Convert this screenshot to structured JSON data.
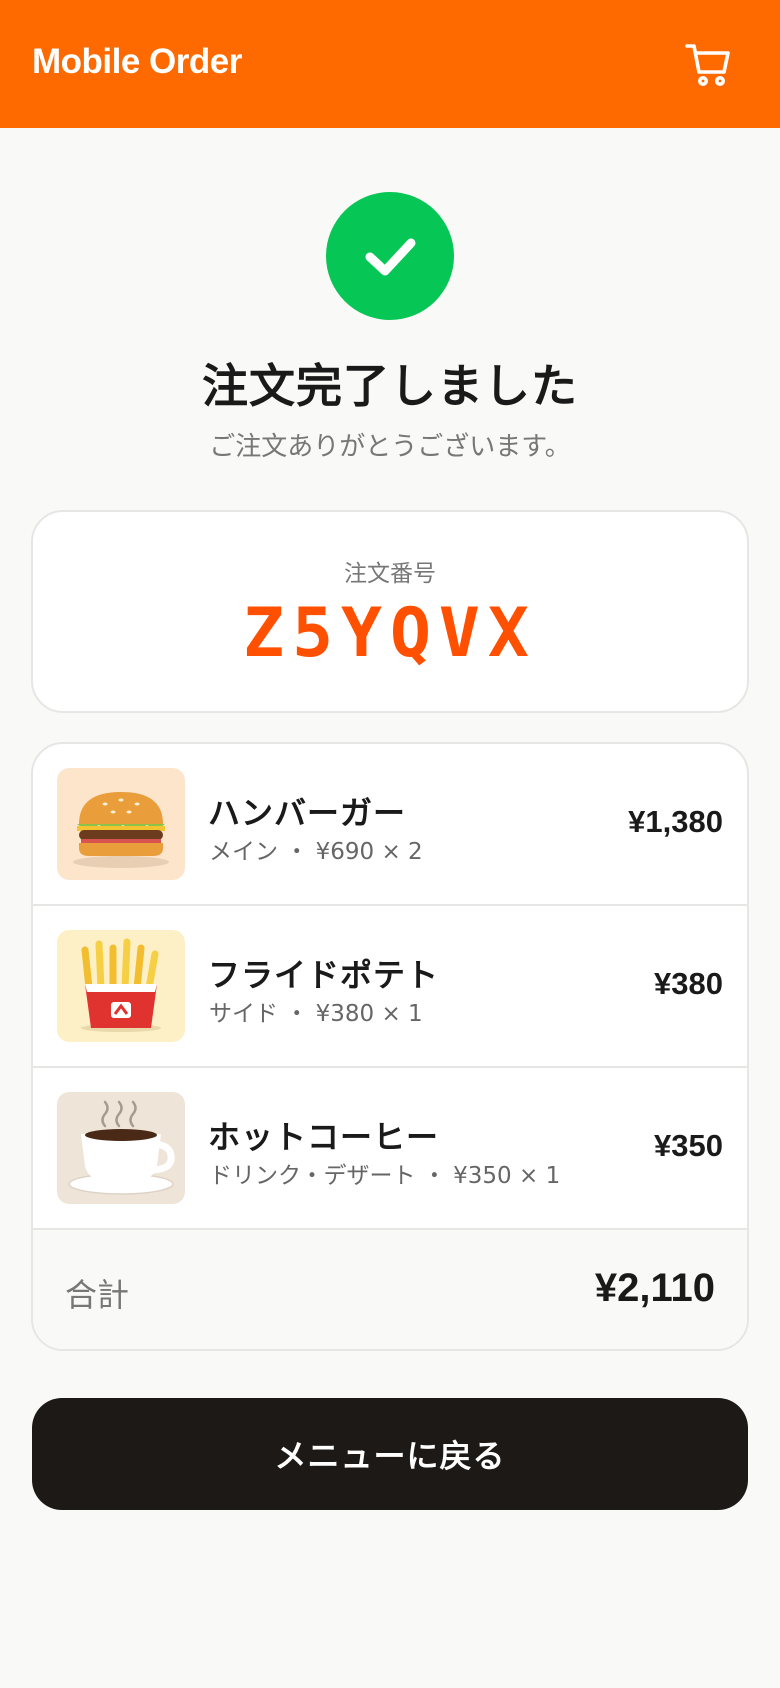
{
  "header": {
    "title": "Mobile Order",
    "cart_icon": "cart-icon",
    "bg_color": "#ff6a00"
  },
  "confirmation": {
    "icon": "check-icon",
    "icon_color": "#06c755",
    "title": "注文完了しました",
    "subtitle": "ご注文ありがとうございます。"
  },
  "order": {
    "label": "注文番号",
    "number": "Z5YQVX",
    "number_color": "#ff4f00"
  },
  "items": [
    {
      "icon": "hamburger-icon",
      "name": "ハンバーガー",
      "meta": "メイン ・ ¥690 × 2",
      "price": "¥1,380"
    },
    {
      "icon": "french-fries-icon",
      "name": "フライドポテト",
      "meta": "サイド ・ ¥380 × 1",
      "price": "¥380"
    },
    {
      "icon": "hot-coffee-icon",
      "name": "ホットコーヒー",
      "meta": "ドリンク・デザート ・ ¥350 × 1",
      "price": "¥350"
    }
  ],
  "total": {
    "label": "合計",
    "value": "¥2,110"
  },
  "back_button": {
    "label": "メニューに戻る"
  }
}
